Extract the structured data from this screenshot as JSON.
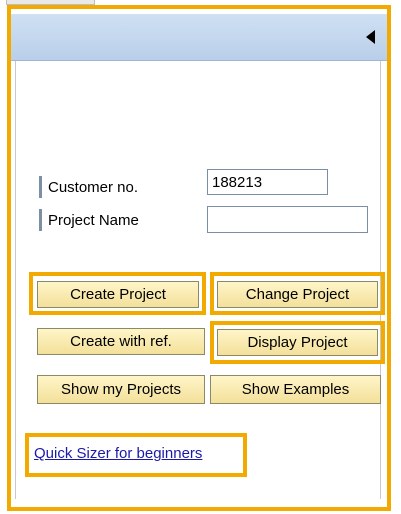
{
  "header": {
    "collapse_icon": "triangle-left-icon"
  },
  "form": {
    "customer_label": "Customer no.",
    "customer_value": "188213",
    "project_label": "Project Name",
    "project_value": ""
  },
  "buttons": {
    "create_project": "Create Project",
    "change_project": "Change Project",
    "create_with_ref": "Create with ref.",
    "display_project": "Display Project",
    "show_my_projects": "Show my Projects",
    "show_examples": "Show Examples"
  },
  "links": {
    "quick_sizer": "Quick Sizer for beginners"
  },
  "colors": {
    "highlight": "#f2a900",
    "button_fill": "#f3e09a",
    "header_fill": "#c3d7ee",
    "link": "#1a1aa8"
  }
}
